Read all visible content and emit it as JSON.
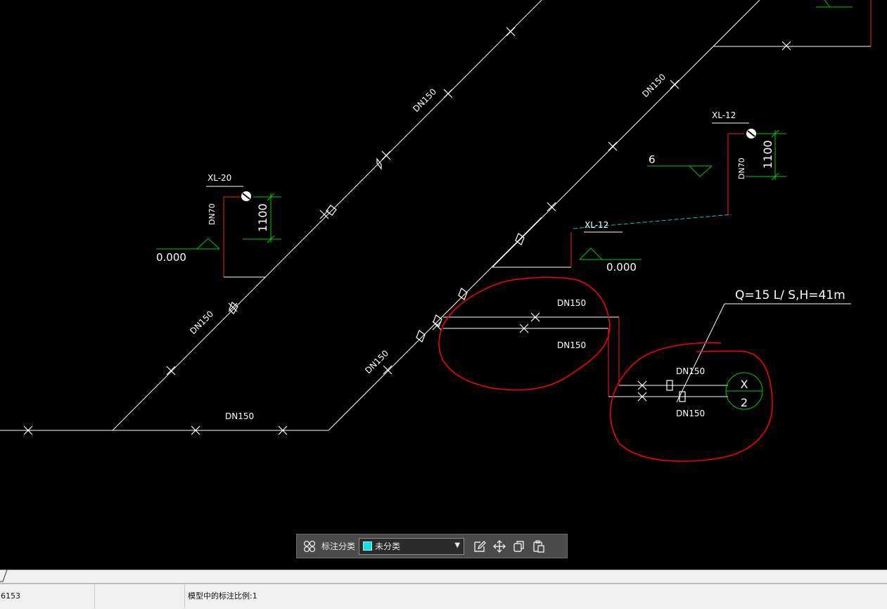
{
  "drawing": {
    "pipe_labels": {
      "dn150_diag_a": "DN150",
      "dn150_diag_b": "DN150",
      "dn150_diag_c": "DN150",
      "dn150_diag_d": "DN150",
      "dn150_horiz_bottom": "DN150",
      "dn150_upper_branch": "DN150",
      "dn150_lower_branch": "DN150",
      "dn150_pump_upper": "DN150",
      "dn150_pump_lower": "DN150",
      "dn70_left": "DN70",
      "dn70_right": "DN70"
    },
    "riser_tags": {
      "xl20": "XL-20",
      "xl12_top": "XL-12",
      "xl12_mid": "XL-12"
    },
    "elevations": {
      "left_level": "0.000",
      "mid_level": "0.000",
      "right_step": "6"
    },
    "dimensions": {
      "left_height": "1100",
      "right_height": "1100"
    },
    "pump": {
      "spec": "Q=15 L/ S,H=41m",
      "symbol": "X",
      "number": "2"
    },
    "colors": {
      "pipe": "#ffffff",
      "riser_pipe": "#ff1a1a",
      "level_mark": "#00cc00",
      "markup": "#ff0000",
      "leader": "#00cccc"
    }
  },
  "toolbar": {
    "grid_icon": "grid-icon",
    "label": "标注分类",
    "category_value": "未分类",
    "category_color": "#00e5ee",
    "edit_icon": "edit-icon",
    "move_icon": "move-icon",
    "copy_icon": "copy-icon",
    "paste_icon": "paste-icon"
  },
  "status": {
    "coordinate": "6153",
    "annotation_scale": "模型中的标注比例:1"
  }
}
